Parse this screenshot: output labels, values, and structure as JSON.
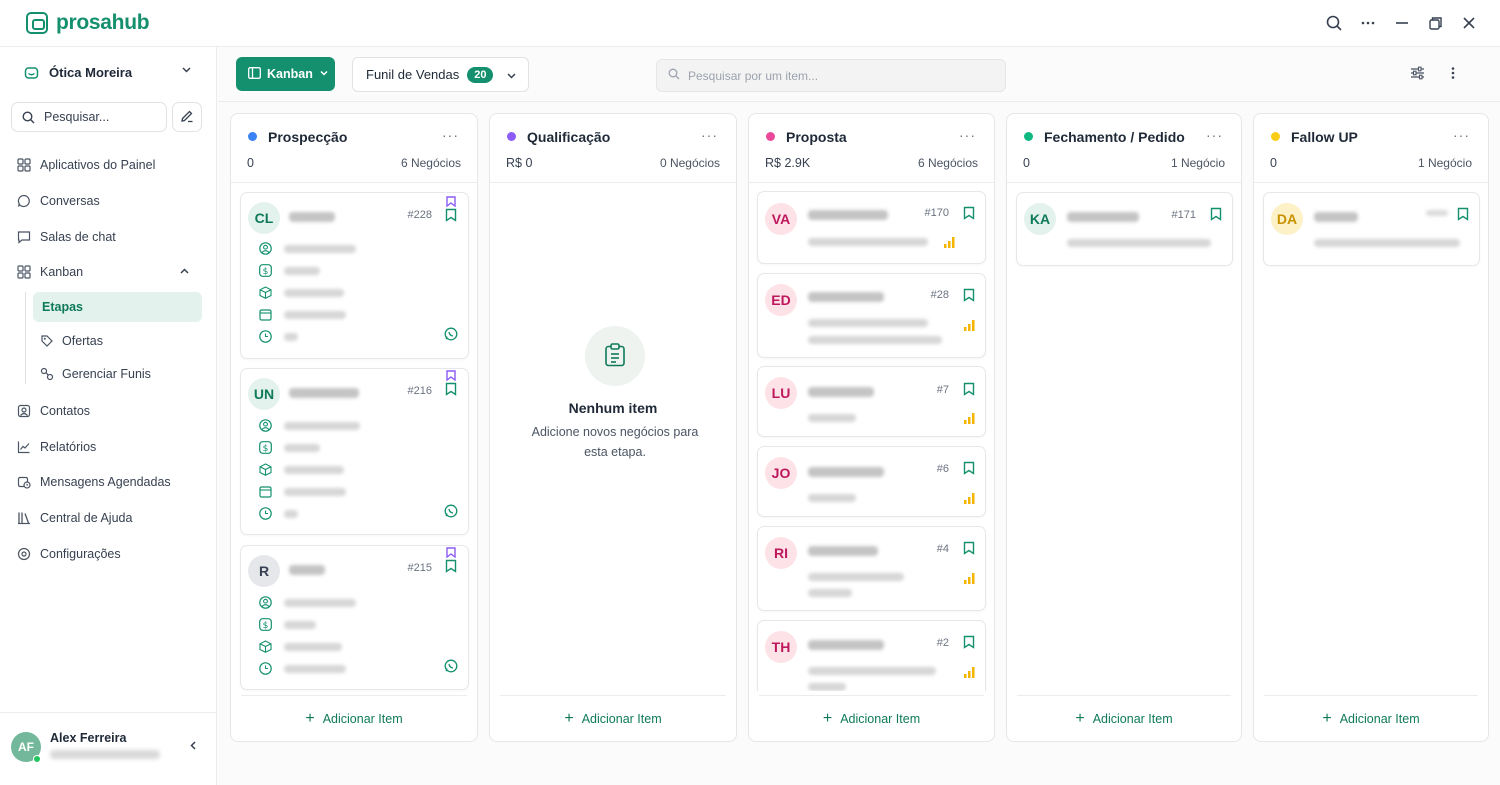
{
  "app": {
    "name": "prosahub"
  },
  "workspace": {
    "name": "Ótica Moreira"
  },
  "sidebar": {
    "search_placeholder": "Pesquisar...",
    "items": [
      {
        "label": "Aplicativos do Painel",
        "icon": "grid-icon"
      },
      {
        "label": "Conversas",
        "icon": "chat-bubble-icon"
      },
      {
        "label": "Salas de chat",
        "icon": "chat-room-icon"
      },
      {
        "label": "Kanban",
        "icon": "kanban-icon"
      },
      {
        "label": "Contatos",
        "icon": "contacts-icon"
      },
      {
        "label": "Relatórios",
        "icon": "chart-line-icon"
      },
      {
        "label": "Mensagens Agendadas",
        "icon": "scheduled-icon"
      },
      {
        "label": "Central de Ajuda",
        "icon": "books-icon"
      },
      {
        "label": "Configurações",
        "icon": "gear-icon"
      }
    ],
    "kanban_sub": [
      {
        "label": "Etapas",
        "active": true
      },
      {
        "label": "Ofertas",
        "icon": "offers-icon"
      },
      {
        "label": "Gerenciar Funis",
        "icon": "funnels-icon"
      }
    ]
  },
  "user": {
    "initials": "AF",
    "name": "Alex Ferreira"
  },
  "toolbar": {
    "view_label": "Kanban",
    "funnel_label": "Funil de Vendas",
    "funnel_count": "20",
    "search_placeholder": "Pesquisar por um item..."
  },
  "add_item_label": "Adicionar Item",
  "columns": [
    {
      "title": "Prospecção",
      "dot_color": "#3b82f6",
      "sum": "0",
      "count": "6 Negócios"
    },
    {
      "title": "Qualificação",
      "dot_color": "#8b5cf6",
      "sum": "R$ 0",
      "count": "0 Negócios"
    },
    {
      "title": "Proposta",
      "dot_color": "#ec4899",
      "sum": "R$ 2.9K",
      "count": "6 Negócios"
    },
    {
      "title": "Fechamento / Pedido",
      "dot_color": "#10b981",
      "sum": "0",
      "count": "1 Negócio"
    },
    {
      "title": "Fallow UP",
      "dot_color": "#facc15",
      "sum": "0",
      "count": "1 Negócio"
    }
  ],
  "empty_state": {
    "title": "Nenhum item",
    "description": "Adicione novos negócios para esta etapa."
  },
  "prospeccao_cards": [
    {
      "initials": "CL",
      "id": "#228"
    },
    {
      "initials": "UN",
      "id": "#216"
    },
    {
      "initials": "R",
      "id": "#215"
    }
  ],
  "proposta_cards": [
    {
      "initials": "VA",
      "id": "#170"
    },
    {
      "initials": "ED",
      "id": "#28"
    },
    {
      "initials": "LU",
      "id": "#7"
    },
    {
      "initials": "JO",
      "id": "#6"
    },
    {
      "initials": "RI",
      "id": "#4"
    },
    {
      "initials": "TH",
      "id": "#2"
    }
  ],
  "fechamento_cards": [
    {
      "initials": "KA",
      "id": "#171"
    }
  ],
  "followup_cards": [
    {
      "initials": "DA"
    }
  ],
  "colors": {
    "brand": "#14906e",
    "brand_light": "#e3f2ec",
    "priority": "#f5b400",
    "bookmark_purple": "#8b5cf6"
  }
}
